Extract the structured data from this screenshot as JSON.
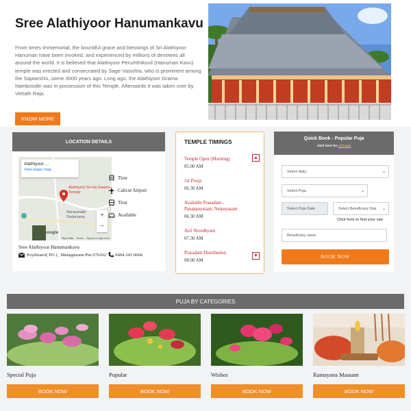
{
  "hero": {
    "title": "Sree Alathiyoor Hanumankavu",
    "description": "From times immemorial, the bountiful grace and blessings of Sri Alathiyoor Hanuman have been invoked, and experienced by millions of devotees all around the world. It is believed that Alathiyoor Perumthikovil (Hanuman Kavu) temple was erected and consecrated by Sage Vasishta, who is prominent among the Saptarshis, some 3000 years ago. Long ago, the Alathiyoor Grama Namboodiri was in possession of this Temple. Afterwards it was taken over by Vettath Raja.",
    "know_more_label": "KNOW MORE"
  },
  "location": {
    "header": "LOCATION DETAILS",
    "map_place": "Alathiyoor ...",
    "map_link": "View larger map",
    "map_pin_label": "Alathiyoor Sri Ha Swamy Temple",
    "map_area_1": "Narayanath",
    "map_area_2": "Sudarsana",
    "map_footer_1": "Map Data",
    "map_footer_2": "Terms",
    "map_footer_3": "Report a map error",
    "map_brand": "Google",
    "items": [
      {
        "icon": "train-icon",
        "label": "Tirur"
      },
      {
        "icon": "plane-icon",
        "label": "Calicut Airport"
      },
      {
        "icon": "bus-icon",
        "label": "Tirur"
      },
      {
        "icon": "car-icon",
        "label": "Available"
      }
    ],
    "temple_name": "Sree Alathiyoor Hanumankavu",
    "address": "Poyilisseri( PO ) , Malappuram Pin 676102",
    "phone": "0494 243 0666"
  },
  "timings": {
    "header": "TEMPLE TIMINGS",
    "items": [
      {
        "name": "Temple Open (Morning)",
        "time": "05.00 AM"
      },
      {
        "name": "1st Pooja",
        "time": "06.30 AM"
      },
      {
        "name": "Available Prasadam - Panappayasam, Neipayasam",
        "time": "06.30 AM"
      },
      {
        "name": "Avil Nivedhyam",
        "time": "07.30 AM"
      },
      {
        "name": "Prasadam Distribution",
        "time": "08.00 AM"
      }
    ]
  },
  "quick_book": {
    "title": "Quick Book - Popular Puja",
    "subtitle_prefix": "click here for",
    "subtitle_link": "All Pujas",
    "deity_placeholder": "Select deity",
    "puja_placeholder": "Select Puja",
    "date_placeholder": "Select Puja Date",
    "star_placeholder": "Select Beneficiary Star",
    "find_star_link": "Click here to find your star",
    "beneficiary_placeholder": "Beneficiary name",
    "book_label": "BOOK NOW"
  },
  "categories": {
    "header": "PUJA BY CATEGORIES",
    "items": [
      {
        "label": "Special Puja",
        "button": "BOOK NOW"
      },
      {
        "label": "Popular",
        "button": "BOOK NOW"
      },
      {
        "label": "Wishes",
        "button": "BOOK NOW"
      },
      {
        "label": "Ramayana Maasam",
        "button": "BOOK NOW"
      }
    ]
  },
  "colors": {
    "accent_orange": "#ef7a1c",
    "header_gray": "#6b6b6b",
    "timing_red": "#c02428"
  }
}
